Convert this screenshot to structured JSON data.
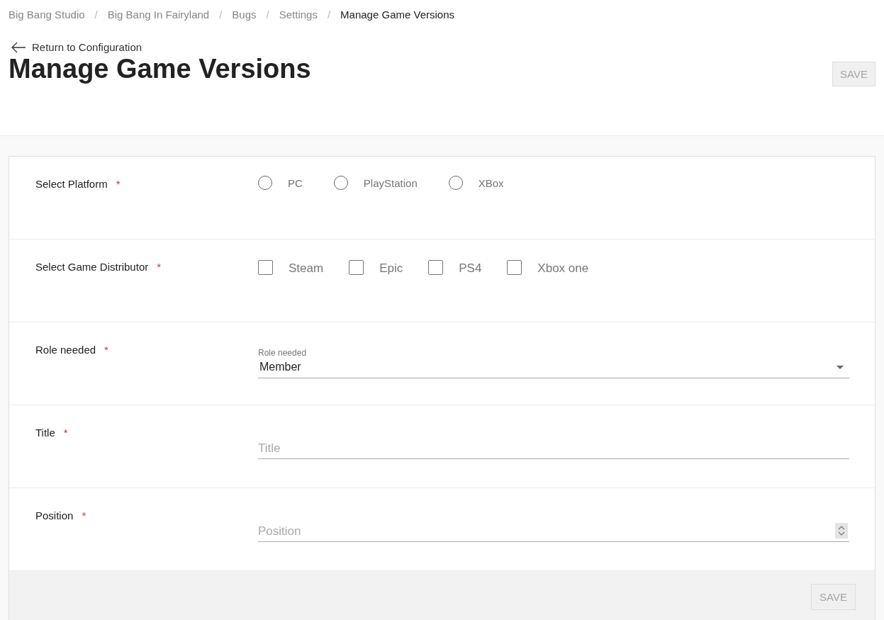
{
  "breadcrumbs": [
    {
      "label": "Big Bang Studio",
      "current": false
    },
    {
      "label": "Big Bang In Fairyland",
      "current": false
    },
    {
      "label": "Bugs",
      "current": false
    },
    {
      "label": "Settings",
      "current": false
    },
    {
      "label": "Manage Game Versions",
      "current": true
    }
  ],
  "separator": "/",
  "back_link": "Return to Configuration",
  "title": "Manage Game Versions",
  "header_button": {
    "label": "SAVE",
    "disabled": true
  },
  "fields": [
    {
      "kind": "radio",
      "label": "Select Platform",
      "required": true,
      "options": [
        {
          "label": "PC",
          "selected": false
        },
        {
          "label": "PlayStation",
          "selected": false
        },
        {
          "label": "XBox",
          "selected": false
        }
      ]
    },
    {
      "kind": "checkbox",
      "label": "Select Game Distributor",
      "required": true,
      "options": [
        {
          "label": "Steam",
          "checked": false
        },
        {
          "label": "Epic",
          "checked": false
        },
        {
          "label": "PS4",
          "checked": false
        },
        {
          "label": "Xbox one",
          "checked": false
        }
      ]
    },
    {
      "kind": "select",
      "label": "Role needed",
      "required": true,
      "floating_label": "Role needed",
      "value": "Member"
    },
    {
      "kind": "text",
      "label": "Title",
      "required": true,
      "placeholder": "Title"
    },
    {
      "kind": "number",
      "label": "Position",
      "required": true,
      "placeholder": "Position"
    }
  ],
  "required_mark": "*",
  "footer_button": {
    "label": "SAVE",
    "disabled": true
  }
}
